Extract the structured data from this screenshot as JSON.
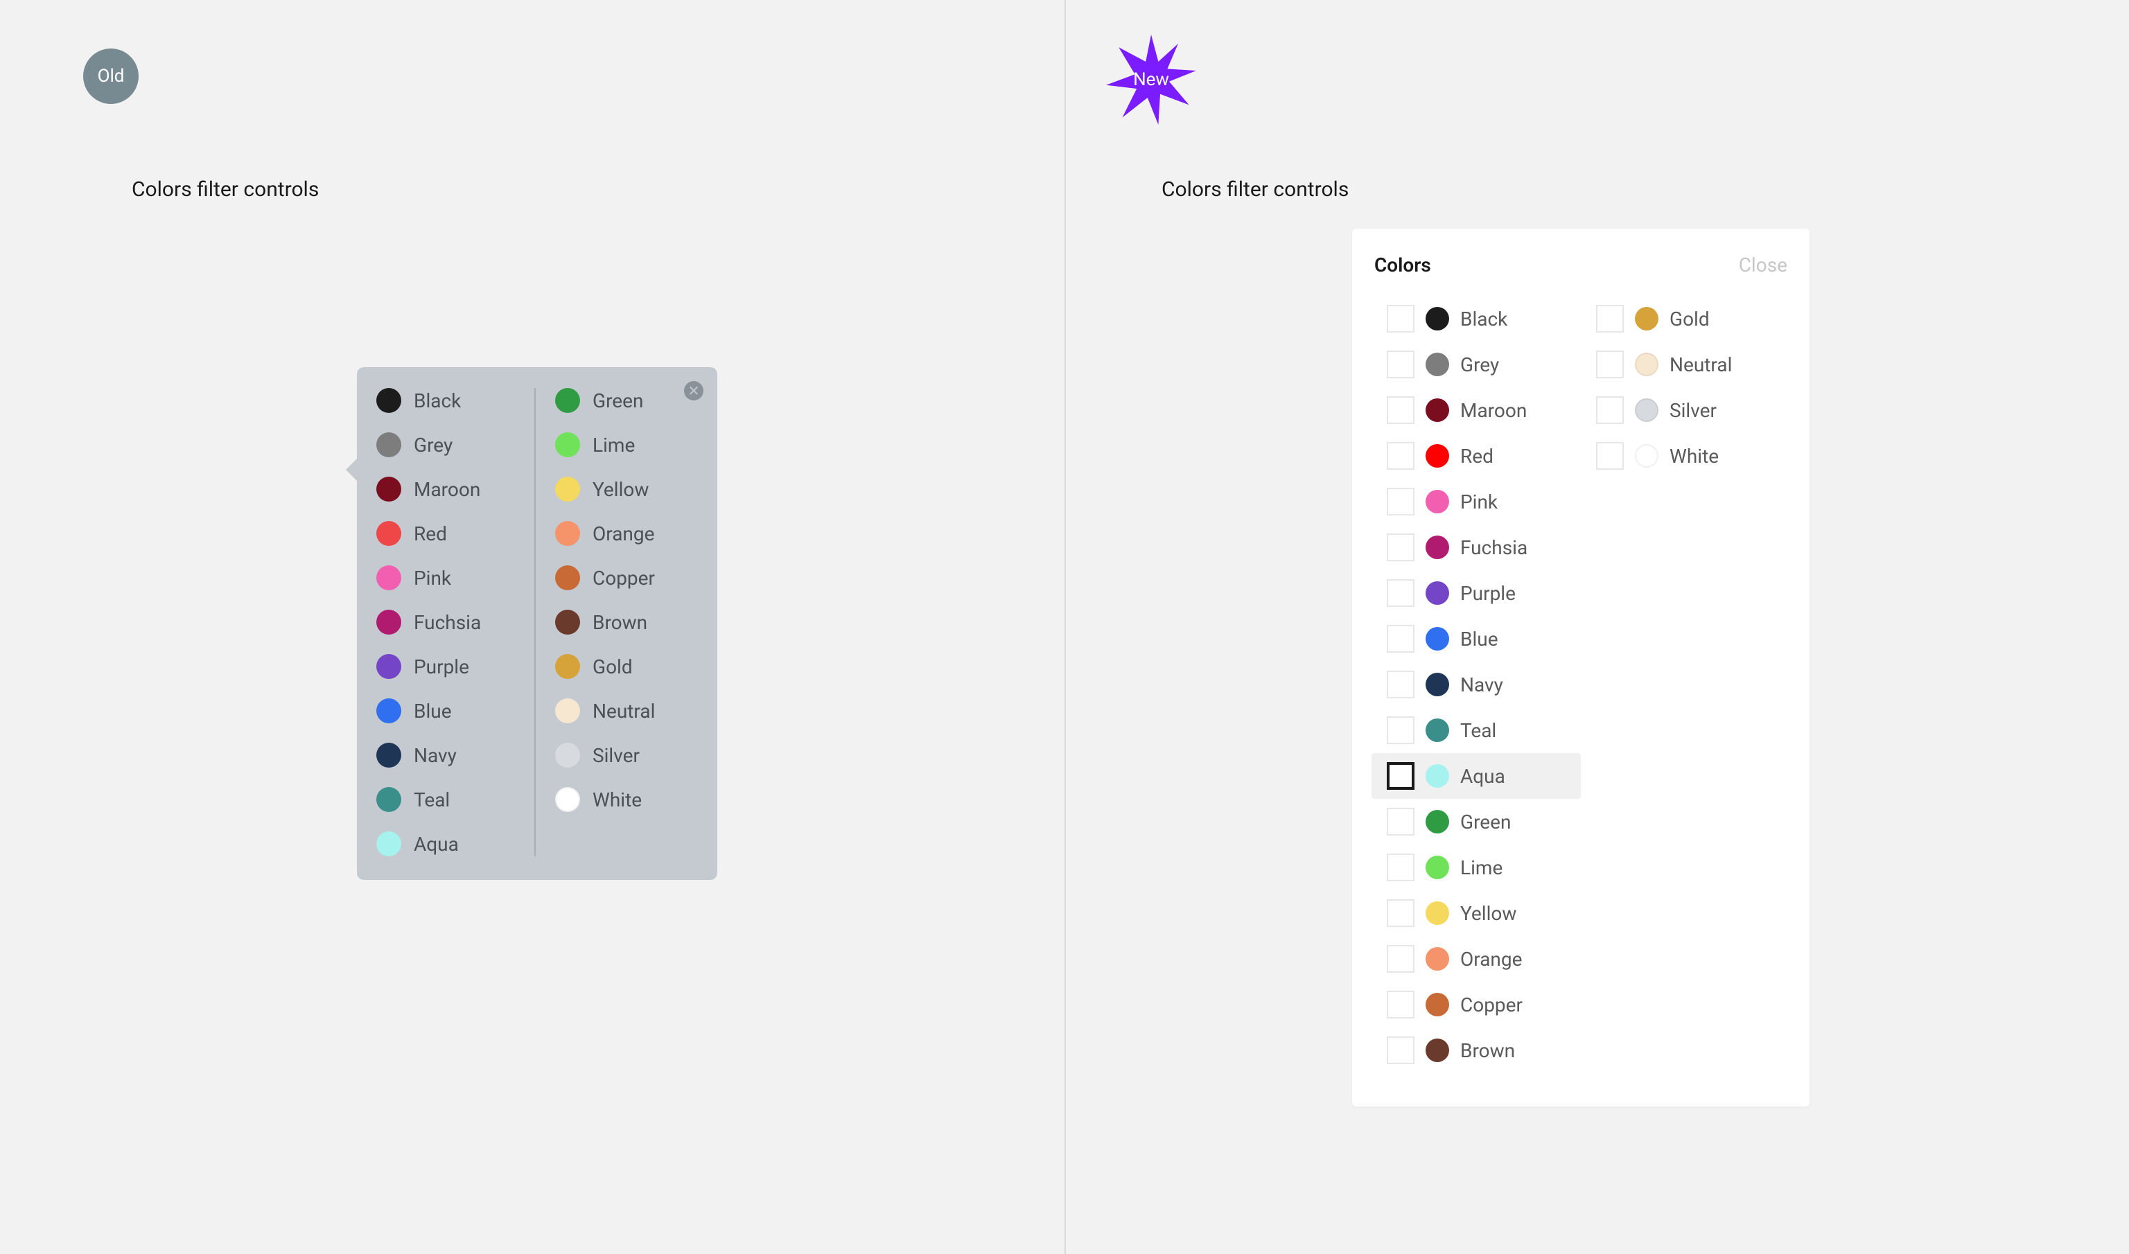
{
  "badges": {
    "old_label": "Old",
    "new_label": "New"
  },
  "old": {
    "section_title": "Colors filter controls",
    "left_column": [
      {
        "name": "Black",
        "hex": "#1c1c1c"
      },
      {
        "name": "Grey",
        "hex": "#7d7d7d"
      },
      {
        "name": "Maroon",
        "hex": "#7a0e1e"
      },
      {
        "name": "Red",
        "hex": "#ef4747"
      },
      {
        "name": "Pink",
        "hex": "#f25fb1"
      },
      {
        "name": "Fuchsia",
        "hex": "#b01b6f"
      },
      {
        "name": "Purple",
        "hex": "#7545c8"
      },
      {
        "name": "Blue",
        "hex": "#2f6ff0"
      },
      {
        "name": "Navy",
        "hex": "#1e3555"
      },
      {
        "name": "Teal",
        "hex": "#3a8f8a"
      },
      {
        "name": "Aqua",
        "hex": "#a6f2ef"
      }
    ],
    "right_column": [
      {
        "name": "Green",
        "hex": "#2f9c44"
      },
      {
        "name": "Lime",
        "hex": "#6fe25a"
      },
      {
        "name": "Yellow",
        "hex": "#f5d95f"
      },
      {
        "name": "Orange",
        "hex": "#f5936a"
      },
      {
        "name": "Copper",
        "hex": "#c86a36"
      },
      {
        "name": "Brown",
        "hex": "#6a3a2c"
      },
      {
        "name": "Gold",
        "hex": "#d6a33a"
      },
      {
        "name": "Neutral",
        "hex": "#f7e7d0"
      },
      {
        "name": "Silver",
        "hex": "#d7dbe0"
      },
      {
        "name": "White",
        "hex": "#ffffff"
      }
    ]
  },
  "new": {
    "section_title": "Colors filter controls",
    "panel_title": "Colors",
    "close_label": "Close",
    "highlighted": "Aqua",
    "left_column": [
      {
        "name": "Black",
        "hex": "#1c1c1c"
      },
      {
        "name": "Grey",
        "hex": "#7d7d7d"
      },
      {
        "name": "Maroon",
        "hex": "#7a0e1e"
      },
      {
        "name": "Red",
        "hex": "#ff0000"
      },
      {
        "name": "Pink",
        "hex": "#f25fb1"
      },
      {
        "name": "Fuchsia",
        "hex": "#b01b6f"
      },
      {
        "name": "Purple",
        "hex": "#7545c8"
      },
      {
        "name": "Blue",
        "hex": "#2f6ff0"
      },
      {
        "name": "Navy",
        "hex": "#1e3555"
      },
      {
        "name": "Teal",
        "hex": "#3a8f8a"
      },
      {
        "name": "Aqua",
        "hex": "#a6f2ef"
      },
      {
        "name": "Green",
        "hex": "#2f9c44"
      },
      {
        "name": "Lime",
        "hex": "#6fe25a"
      },
      {
        "name": "Yellow",
        "hex": "#f5d95f"
      },
      {
        "name": "Orange",
        "hex": "#f5936a"
      },
      {
        "name": "Copper",
        "hex": "#c86a36"
      },
      {
        "name": "Brown",
        "hex": "#6a3a2c"
      }
    ],
    "right_column": [
      {
        "name": "Gold",
        "hex": "#d6a33a"
      },
      {
        "name": "Neutral",
        "hex": "#f7e7d0"
      },
      {
        "name": "Silver",
        "hex": "#d7dbe0"
      },
      {
        "name": "White",
        "hex": "#ffffff"
      }
    ]
  }
}
